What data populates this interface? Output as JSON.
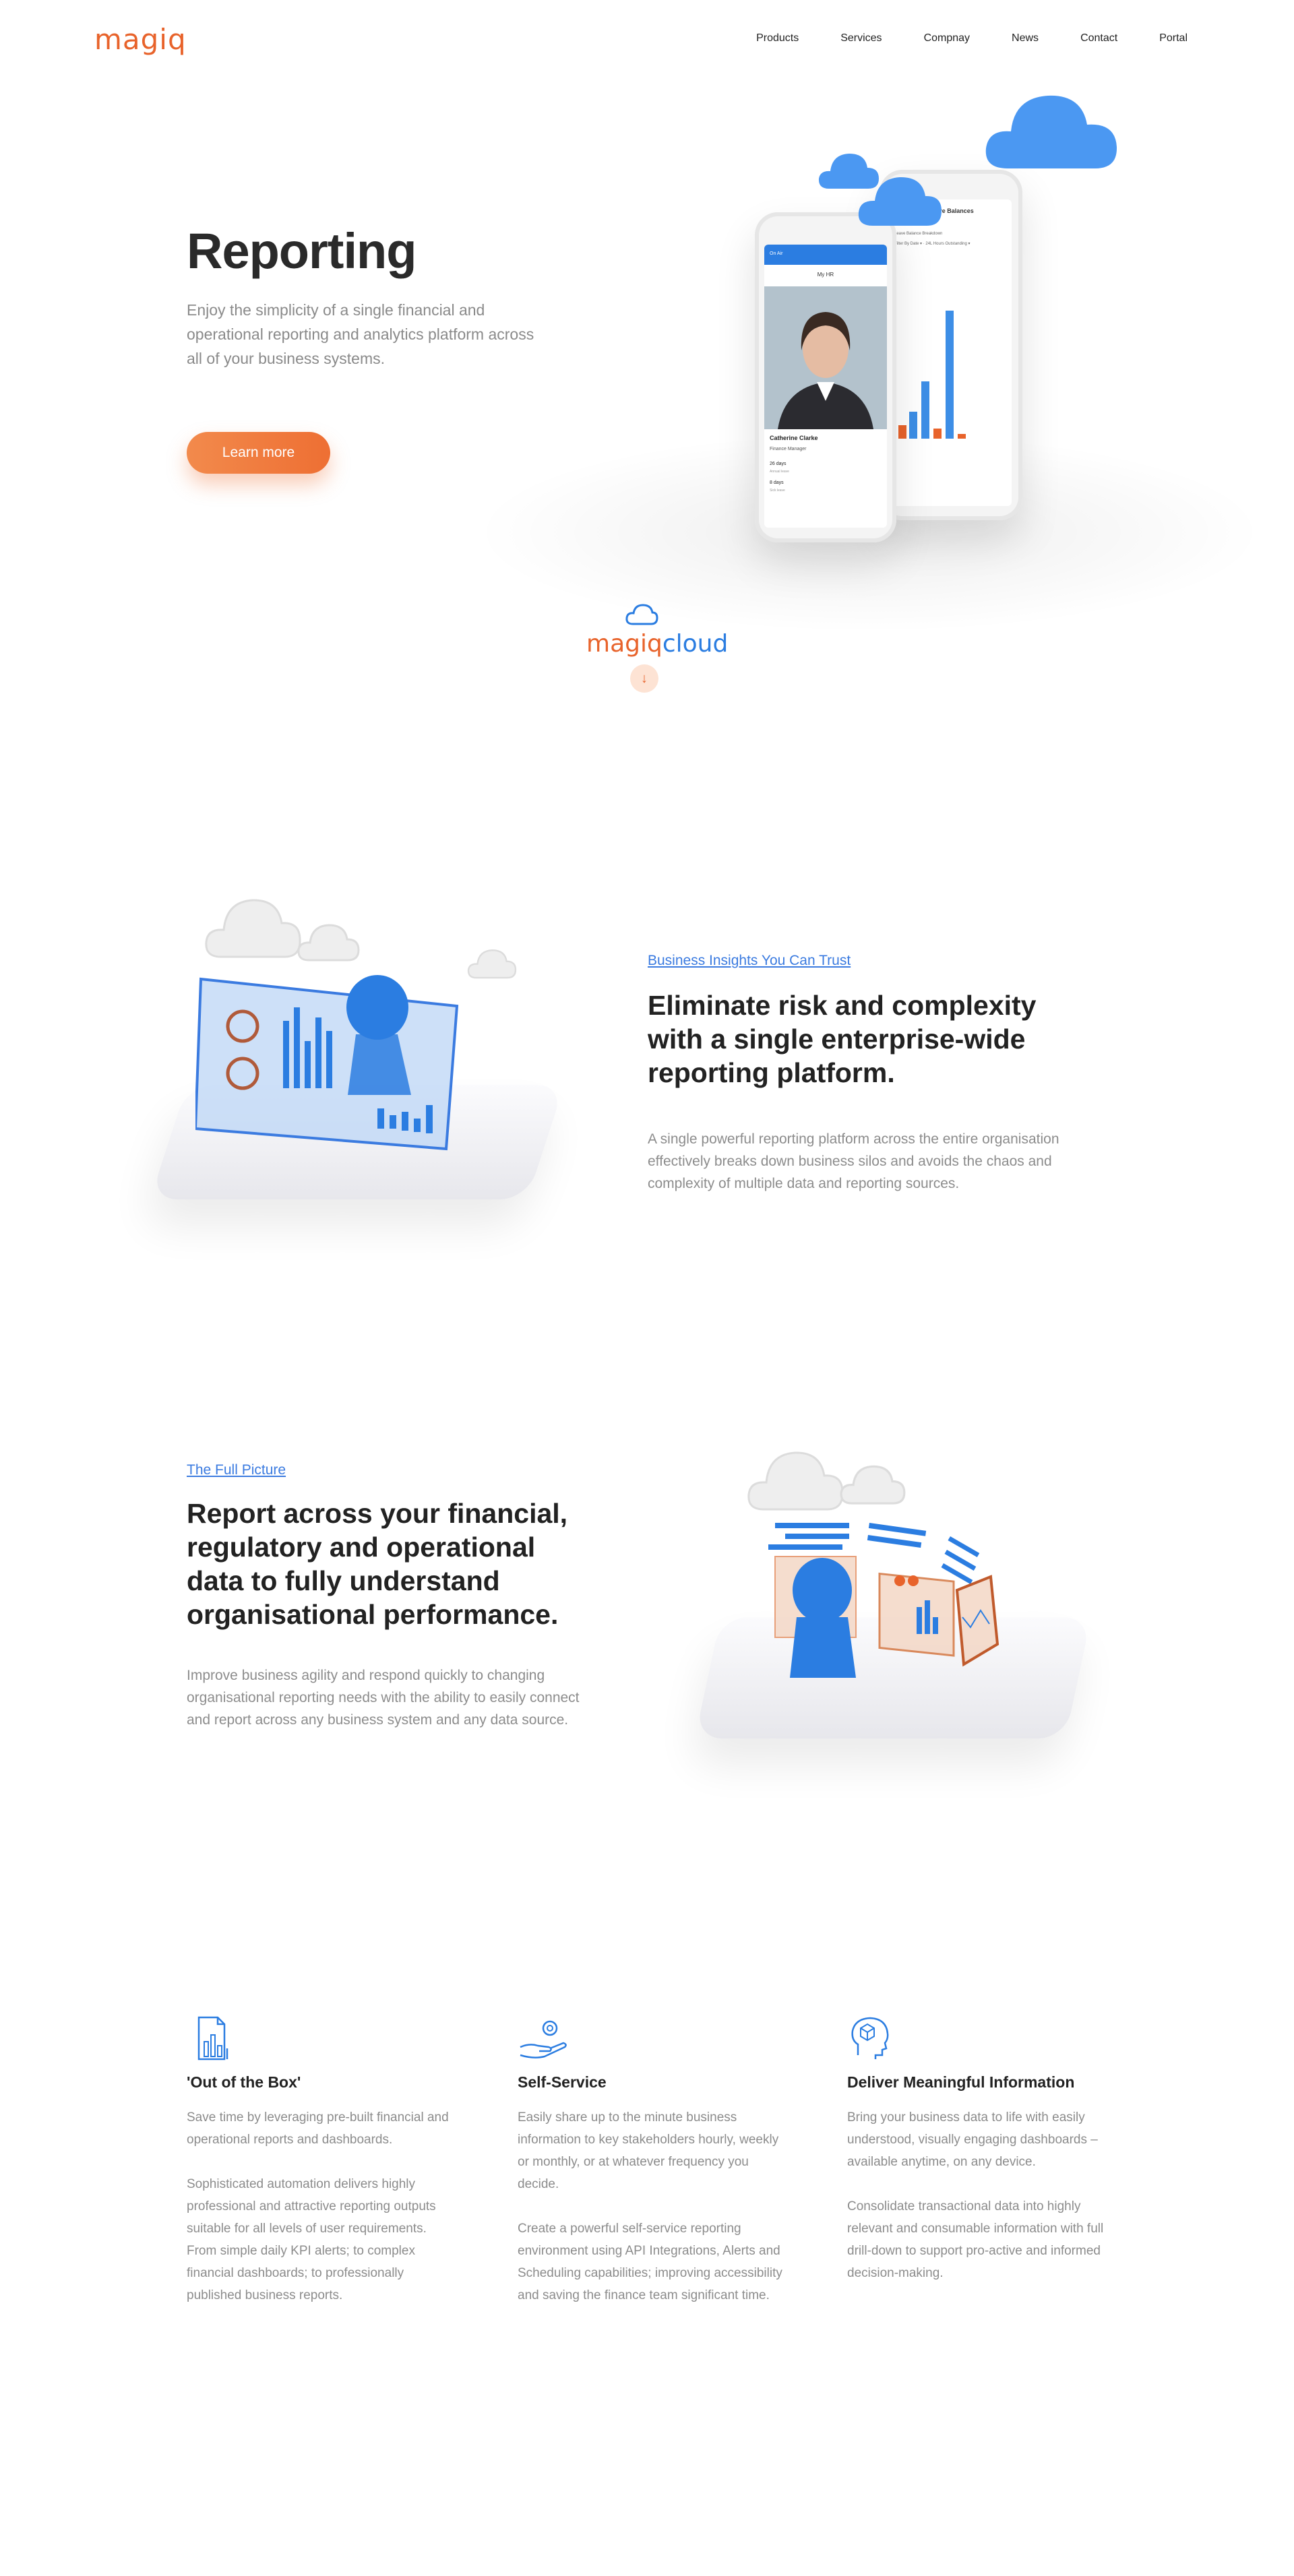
{
  "header": {
    "logo": "magiq",
    "nav": [
      "Products",
      "Services",
      "Compnay",
      "News",
      "Contact",
      "Portal"
    ]
  },
  "hero": {
    "title": "Reporting",
    "subtitle": "Enjoy the simplicity of a single financial and operational reporting and analytics platform across all of your business systems.",
    "button": "Learn more",
    "phone_front": {
      "status": "On Air",
      "app_title": "My HR",
      "name": "Catherine Clarke",
      "role": "Finance Manager",
      "row1_value": "26 days",
      "row1_label": "Annual leave",
      "row2_value": "8 days",
      "row2_label": "Sick leave"
    },
    "phone_back": {
      "title": "Leave Balances",
      "row1": "Leave Balance Breakdown",
      "row2": "Filter By Date ▾ · 24L Hours Outstanding ▾"
    }
  },
  "cloud_brand": {
    "part1": "magiq",
    "part2": "cloud"
  },
  "section1": {
    "eyebrow": "Business Insights You Can Trust",
    "heading": "Eliminate risk and complexity with a single enterprise-wide reporting platform.",
    "body": "A single powerful reporting platform across the entire organisation effectively breaks down business silos and avoids the chaos and complexity of multiple data and reporting sources."
  },
  "section2": {
    "eyebrow": "The Full Picture",
    "heading": "Report across your financial, regulatory and operational data to fully understand organisational performance.",
    "body": "Improve business agility and respond quickly to changing organisational reporting needs with the ability to easily connect and report across any business system and any data source."
  },
  "features": [
    {
      "icon": "report-document-icon",
      "title": "'Out of the Box'",
      "p1": "Save time by leveraging pre-built financial and operational reports and dashboards.",
      "p2": "Sophisticated automation delivers highly professional and attractive reporting outputs suitable for all levels of user requirements. From simple daily KPI alerts; to complex financial dashboards; to professionally published business reports."
    },
    {
      "icon": "hand-gear-icon",
      "title": "Self-Service",
      "p1": "Easily share up to the minute business information to key stakeholders hourly, weekly or monthly, or at whatever frequency you decide.",
      "p2": "Create a powerful self-service reporting environment using API Integrations, Alerts and Scheduling capabilities; improving accessibility and saving the finance team significant time."
    },
    {
      "icon": "head-cube-icon",
      "title": "Deliver Meaningful Information",
      "p1": "Bring your business data to life with easily understood, visually engaging dashboards – available anytime, on any device.",
      "p2": "Consolidate transactional data into highly relevant and consumable information with full drill-down to support pro-active and informed decision-making."
    }
  ],
  "colors": {
    "brand_orange": "#e8632b",
    "accent_blue": "#2b7de1",
    "text_gray": "#8c8c8c"
  }
}
